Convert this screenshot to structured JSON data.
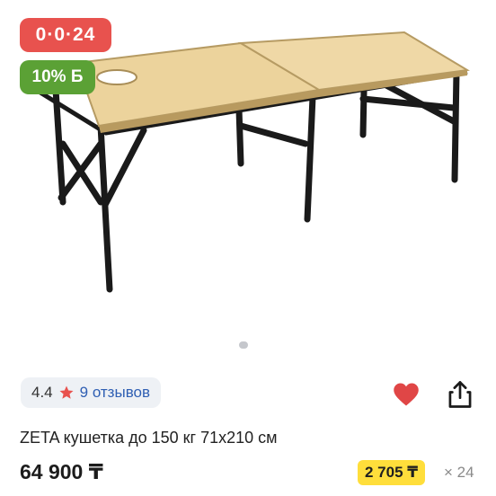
{
  "badges": {
    "installment": "0·0·24",
    "bonus": "10% Б"
  },
  "gallery": {
    "image": "folding-massage-table"
  },
  "rating": {
    "value": "4.4",
    "reviews": "9 отзывов"
  },
  "product": {
    "title": "ZETA кушетка до 150 кг 71x210 см",
    "price": "64 900 ₸"
  },
  "installment": {
    "monthly": "2 705 ₸",
    "months": "× 24"
  },
  "icons": {
    "favorite": "heart-icon",
    "share": "share-icon",
    "star": "star-icon"
  },
  "colors": {
    "installment_badge": "#e8524e",
    "bonus_badge": "#5ba135",
    "installment_price_bg": "#ffde3b",
    "heart": "#e04646",
    "link": "#2f5fb3"
  }
}
